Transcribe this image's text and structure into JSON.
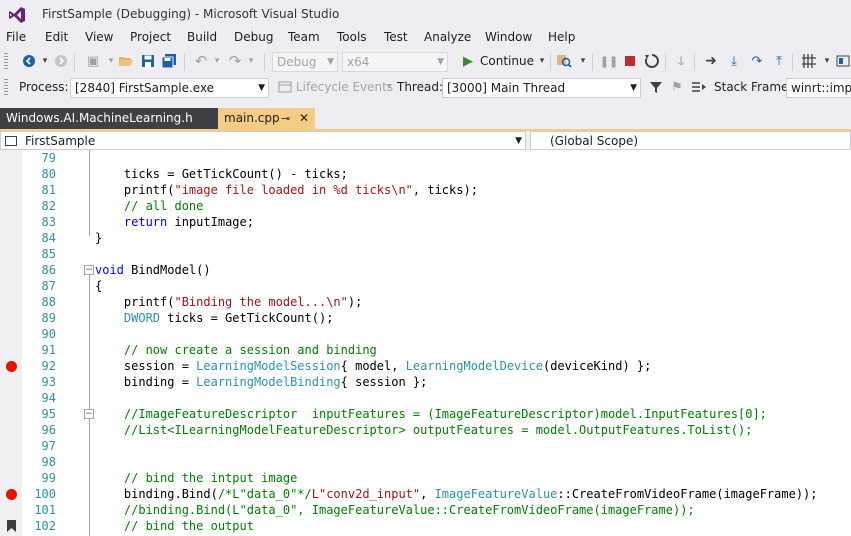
{
  "window": {
    "title": "FirstSample (Debugging) - Microsoft Visual Studio",
    "icon": "visual-studio-logo"
  },
  "menu": [
    "File",
    "Edit",
    "View",
    "Project",
    "Build",
    "Debug",
    "Team",
    "Tools",
    "Test",
    "Analyze",
    "Window",
    "Help"
  ],
  "toolbar": {
    "config_value": "Debug",
    "platform_value": "x64",
    "continue_label": "Continue",
    "icons": [
      "back-icon",
      "forward-icon",
      "new-project-icon",
      "open-file-icon",
      "save-icon",
      "save-all-icon",
      "undo-icon",
      "redo-icon",
      "continue-icon",
      "find-icon",
      "break-all-icon",
      "stop-icon",
      "restart-icon",
      "hot-reload-icon",
      "show-next-statement-icon",
      "step-into-icon",
      "step-over-icon",
      "step-out-icon",
      "thread-marker-icon"
    ]
  },
  "debug_location": {
    "process_label": "Process:",
    "process_value": "[2840] FirstSample.exe",
    "lifecycle_label": "Lifecycle Events",
    "thread_label": "Thread:",
    "thread_value": "[3000] Main Thread",
    "stack_frame_label": "Stack Frame:",
    "stack_frame_value": "winrt::impl:"
  },
  "tabs": [
    {
      "label": "Windows.AI.MachineLearning.h",
      "active": false
    },
    {
      "label": "main.cpp",
      "active": true
    }
  ],
  "navbar": {
    "project": "FirstSample",
    "scope": "(Global Scope)"
  },
  "code_lines": [
    {
      "n": "79",
      "t": ""
    },
    {
      "n": "80",
      "t": "    ticks = GetTickCount() - ticks;"
    },
    {
      "n": "81",
      "t": "    printf(\"image file loaded in %d ticks\\n\", ticks);"
    },
    {
      "n": "82",
      "t": "    // all done"
    },
    {
      "n": "83",
      "t": "    return inputImage;"
    },
    {
      "n": "84",
      "t": "}"
    },
    {
      "n": "85",
      "t": ""
    },
    {
      "n": "86",
      "t": "void BindModel()"
    },
    {
      "n": "87",
      "t": "{"
    },
    {
      "n": "88",
      "t": "    printf(\"Binding the model...\\n\");"
    },
    {
      "n": "89",
      "t": "    DWORD ticks = GetTickCount();"
    },
    {
      "n": "90",
      "t": ""
    },
    {
      "n": "91",
      "t": "    // now create a session and binding"
    },
    {
      "n": "92",
      "t": "    session = LearningModelSession{ model, LearningModelDevice(deviceKind) };"
    },
    {
      "n": "93",
      "t": "    binding = LearningModelBinding{ session };"
    },
    {
      "n": "94",
      "t": ""
    },
    {
      "n": "95",
      "t": "    //ImageFeatureDescriptor  inputFeatures = (ImageFeatureDescriptor)model.InputFeatures[0];"
    },
    {
      "n": "96",
      "t": "    //List<ILearningModelFeatureDescriptor> outputFeatures = model.OutputFeatures.ToList();"
    },
    {
      "n": "97",
      "t": ""
    },
    {
      "n": "98",
      "t": ""
    },
    {
      "n": "99",
      "t": "    // bind the intput image"
    },
    {
      "n": "100",
      "t": "    binding.Bind(/*L\"data_0\"*/L\"conv2d_input\", ImageFeatureValue::CreateFromVideoFrame(imageFrame));"
    },
    {
      "n": "101",
      "t": "    //binding.Bind(L\"data_0\", ImageFeatureValue::CreateFromVideoFrame(imageFrame));"
    },
    {
      "n": "102",
      "t": "    // bind the output"
    }
  ],
  "breakpoint_lines": [
    "92",
    "100"
  ],
  "bookmark_lines": [
    "102"
  ],
  "colors": {
    "keyword": "#0000ff",
    "string": "#a31515",
    "comment": "#008000",
    "type": "#2b91af",
    "breakpoint": "#e51400",
    "active_tab": "#f5cc84"
  }
}
